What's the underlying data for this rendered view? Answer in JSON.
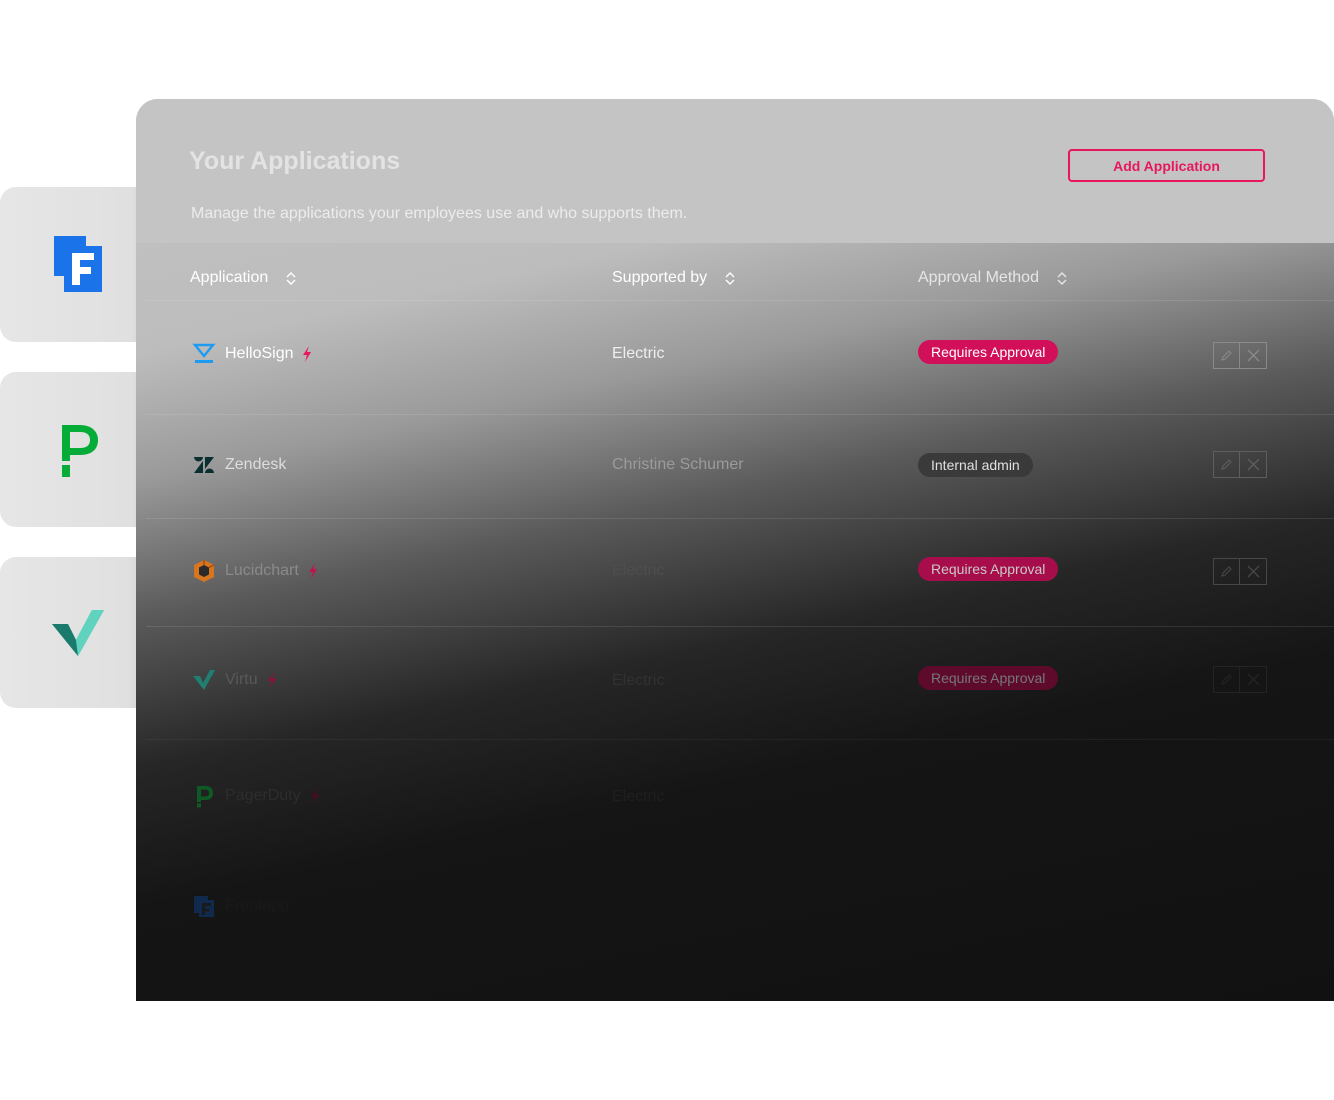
{
  "page": {
    "title": "Your Applications",
    "subtitle": "Manage the applications your employees use and who supports them.",
    "add_button": "Add Application"
  },
  "table": {
    "columns": [
      "Application",
      "Supported by",
      "Approval Method"
    ],
    "rows": [
      {
        "name": "HelloSign",
        "supported_by": "Electric",
        "approval": "Requires Approval",
        "approval_kind": "requires",
        "icon": "hellosign-icon",
        "has_bolt": true,
        "has_actions": true
      },
      {
        "name": "Zendesk",
        "supported_by": "Christine Schumer",
        "approval": "Internal admin",
        "approval_kind": "internal",
        "icon": "zendesk-icon",
        "has_bolt": false,
        "has_actions": true
      },
      {
        "name": "Lucidchart",
        "supported_by": "Electric",
        "approval": "Requires Approval",
        "approval_kind": "requires",
        "icon": "lucidchart-icon",
        "has_bolt": true,
        "has_actions": true
      },
      {
        "name": "Virtu",
        "supported_by": "Electric",
        "approval": "Requires Approval",
        "approval_kind": "requires",
        "icon": "virtu-icon",
        "has_bolt": true,
        "has_actions": true
      },
      {
        "name": "PagerDuty",
        "supported_by": "Electric",
        "approval": "",
        "approval_kind": "",
        "icon": "pagerduty-icon",
        "has_bolt": true,
        "has_actions": false
      },
      {
        "name": "Frontapp",
        "supported_by": "",
        "approval": "",
        "approval_kind": "",
        "icon": "frontapp-icon",
        "has_bolt": false,
        "has_actions": false
      }
    ]
  },
  "side_cards": [
    "frontapp-icon",
    "pagerduty-icon",
    "virtu-icon"
  ],
  "colors": {
    "accent": "#e8175d",
    "badge_requires": "#d2105a",
    "badge_internal": "#3a3a3a",
    "frontapp_blue": "#1a73e8",
    "pagerduty_green": "#06ac38",
    "virtu_teal": "#2bb5a0"
  }
}
